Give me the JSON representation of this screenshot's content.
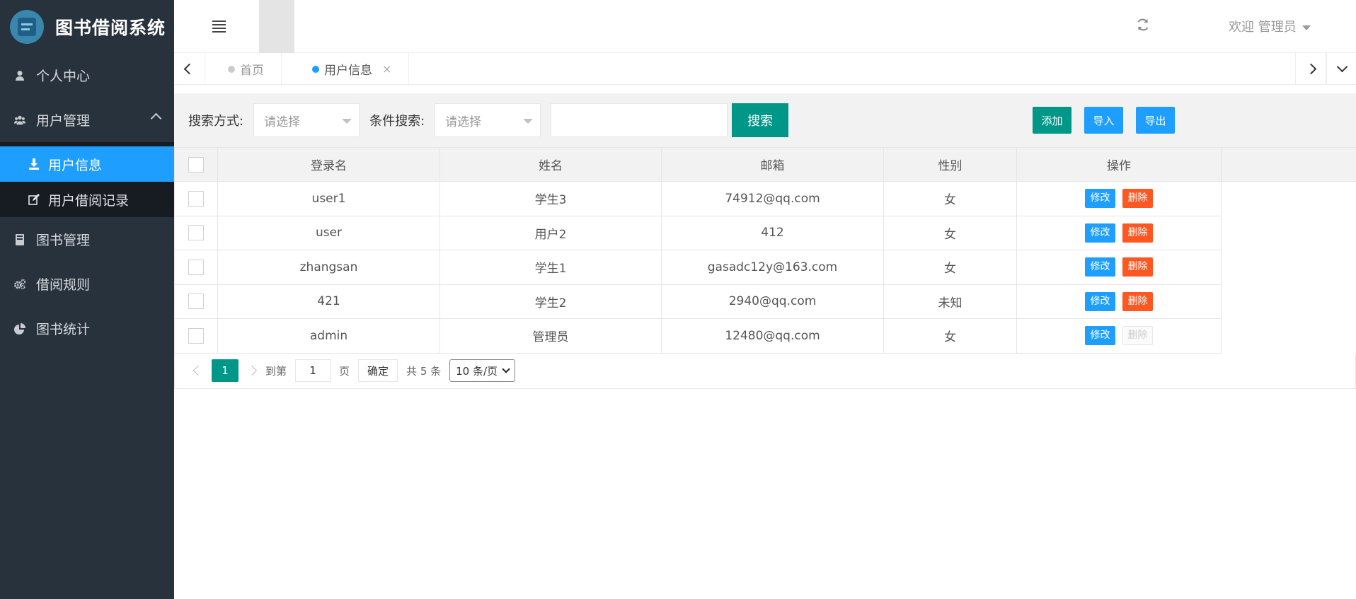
{
  "app": {
    "title": "图书借阅系统"
  },
  "sidebar": {
    "items": [
      {
        "label": "个人中心",
        "icon": "user-icon"
      },
      {
        "label": "用户管理",
        "icon": "users-icon",
        "expanded": true,
        "children": [
          {
            "label": "用户信息",
            "icon": "download-icon",
            "active": true
          },
          {
            "label": "用户借阅记录",
            "icon": "edit-icon"
          }
        ]
      },
      {
        "label": "图书管理",
        "icon": "book-icon"
      },
      {
        "label": "借阅规则",
        "icon": "gears-icon"
      },
      {
        "label": "图书统计",
        "icon": "pie-chart-icon"
      }
    ]
  },
  "header": {
    "welcome": "欢迎 管理员"
  },
  "tabs": [
    {
      "label": "首页",
      "active": false
    },
    {
      "label": "用户信息",
      "active": true,
      "close": "×"
    }
  ],
  "toolbar": {
    "search_mode_label": "搜索方式:",
    "search_mode_placeholder": "请选择",
    "condition_label": "条件搜索:",
    "condition_placeholder": "请选择",
    "search_button": "搜索",
    "add_button": "添加",
    "import_button": "导入",
    "export_button": "导出"
  },
  "table": {
    "headers": [
      "登录名",
      "姓名",
      "邮箱",
      "性别",
      "操作"
    ],
    "rows": [
      {
        "login": "user1",
        "name": "学生3",
        "email": "74912@qq.com",
        "gender": "女",
        "delete_disabled": false
      },
      {
        "login": "user",
        "name": "用户2",
        "email": "412",
        "gender": "女",
        "delete_disabled": false
      },
      {
        "login": "zhangsan",
        "name": "学生1",
        "email": "gasadc12y@163.com",
        "gender": "女",
        "delete_disabled": false
      },
      {
        "login": "421",
        "name": "学生2",
        "email": "2940@qq.com",
        "gender": "未知",
        "delete_disabled": false
      },
      {
        "login": "admin",
        "name": "管理员",
        "email": "12480@qq.com",
        "gender": "女",
        "delete_disabled": true
      }
    ],
    "edit_label": "修改",
    "delete_label": "删除"
  },
  "pager": {
    "current_page": "1",
    "goto_label": "到第",
    "goto_value": "1",
    "page_unit": "页",
    "confirm": "确定",
    "total": "共 5 条",
    "page_size": "10 条/页"
  },
  "colors": {
    "primary": "#009688",
    "blue": "#1e9fff",
    "danger": "#ff5722",
    "sidebar": "#28323d"
  }
}
